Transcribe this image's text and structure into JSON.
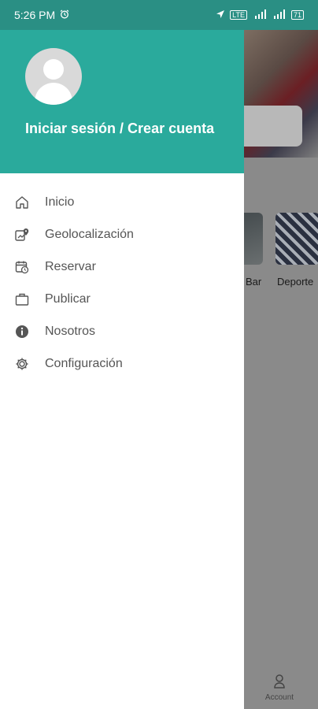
{
  "status_bar": {
    "time": "5:26 PM",
    "lte_badge": "LTE",
    "battery": "71"
  },
  "drawer": {
    "login_text": "Iniciar sesión / Crear cuenta",
    "menu": [
      {
        "label": "Inicio",
        "icon": "home-icon"
      },
      {
        "label": "Geolocalización",
        "icon": "map-pin-icon"
      },
      {
        "label": "Reservar",
        "icon": "calendar-clock-icon"
      },
      {
        "label": "Publicar",
        "icon": "briefcase-icon"
      },
      {
        "label": "Nosotros",
        "icon": "info-icon"
      },
      {
        "label": "Configuración",
        "icon": "gear-icon"
      }
    ]
  },
  "background": {
    "categories": [
      "Bar",
      "Deporte"
    ],
    "bottom_nav_account": "Account"
  },
  "colors": {
    "status_bar": "#2a8f84",
    "drawer_header": "#2aaa9c",
    "scrim": "#8a8a8a"
  }
}
